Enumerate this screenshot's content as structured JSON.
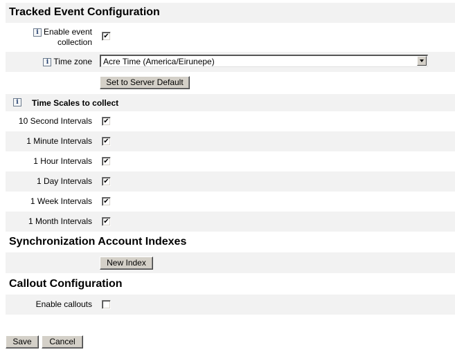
{
  "sections": {
    "tracked_event": {
      "title": "Tracked Event Configuration",
      "enable_event_collection": {
        "label_line1": "Enable event",
        "label_line2": "collection",
        "checked": true
      },
      "time_zone": {
        "label": "Time zone",
        "value": "Acre Time (America/Eirunepe)"
      },
      "set_default_button": "Set to Server Default",
      "time_scales": {
        "title": "Time Scales to collect",
        "items": [
          {
            "label": "10 Second Intervals",
            "checked": true
          },
          {
            "label": "1 Minute Intervals",
            "checked": true
          },
          {
            "label": "1 Hour Intervals",
            "checked": true
          },
          {
            "label": "1 Day Intervals",
            "checked": true
          },
          {
            "label": "1 Week Intervals",
            "checked": true
          },
          {
            "label": "1 Month Intervals",
            "checked": true
          }
        ]
      }
    },
    "sync_indexes": {
      "title": "Synchronization Account Indexes",
      "new_index_button": "New Index"
    },
    "callout": {
      "title": "Callout Configuration",
      "enable_callouts": {
        "label": "Enable callouts",
        "checked": false
      }
    }
  },
  "icons": {
    "info": "i",
    "check": "✔"
  },
  "footer": {
    "save_label": "Save",
    "cancel_label": "Cancel"
  }
}
